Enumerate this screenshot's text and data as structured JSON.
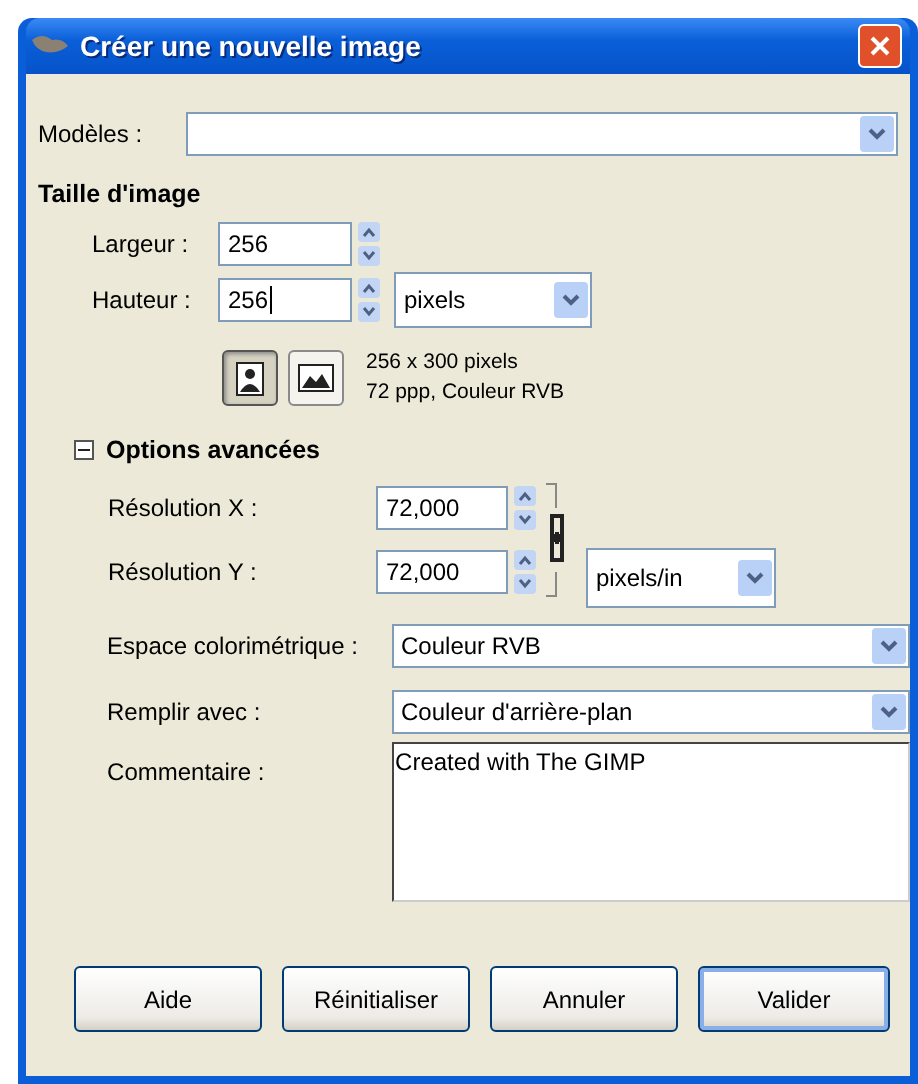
{
  "window": {
    "title": "Créer une nouvelle image"
  },
  "templates": {
    "label": "Modèles :"
  },
  "image_size": {
    "heading": "Taille d'image",
    "width": {
      "label": "Largeur :",
      "value": "256",
      "focused": false
    },
    "height": {
      "label": "Hauteur :",
      "value": "256",
      "focused": true
    },
    "unit": "pixels",
    "orientation": [
      {
        "kind": "portrait",
        "selected": true
      },
      {
        "kind": "landscape",
        "selected": false
      }
    ],
    "info": [
      "256 x 300 pixels",
      "72 ppp, Couleur RVB"
    ]
  },
  "advanced": {
    "heading": "Options avancées",
    "expanded": true,
    "resolution_x": {
      "label": "Résolution X :",
      "value": "72,000"
    },
    "resolution_y": {
      "label": "Résolution Y :",
      "value": "72,000"
    },
    "chained": true,
    "resolution_unit": "pixels/in",
    "color_space": {
      "label": "Espace colorimétrique :",
      "value": "Couleur RVB"
    },
    "fill": {
      "label": "Remplir avec :",
      "value": "Couleur d'arrière-plan"
    },
    "comment": {
      "label": "Commentaire :",
      "value": "Created with The GIMP"
    }
  },
  "buttons": [
    {
      "label": "Aide",
      "default": false
    },
    {
      "label": "Réinitialiser",
      "default": false
    },
    {
      "label": "Annuler",
      "default": false
    },
    {
      "label": "Valider",
      "default": true
    }
  ]
}
